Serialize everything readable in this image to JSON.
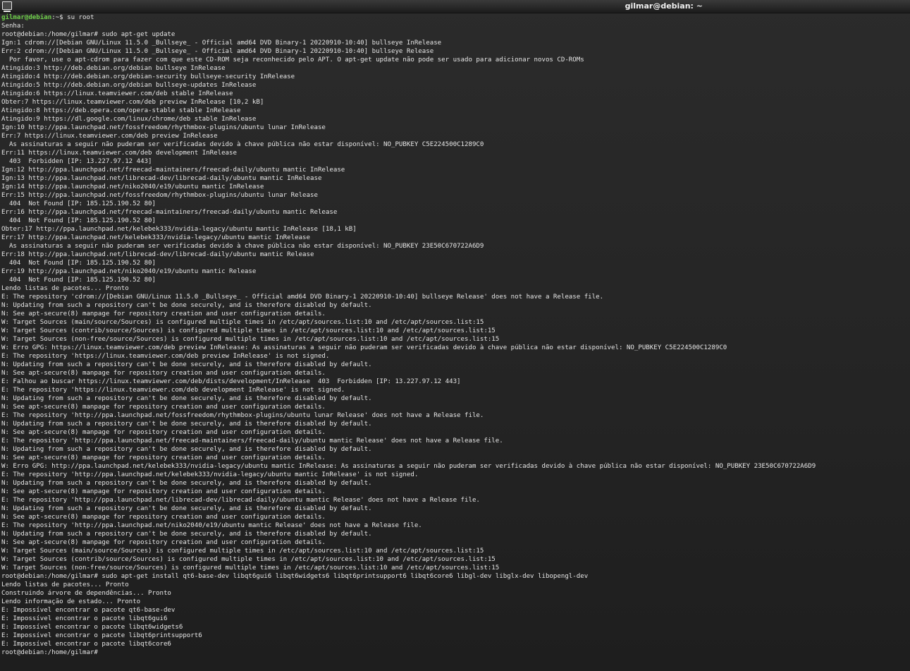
{
  "window": {
    "title": "gilmar@debian: ~",
    "icon": "terminal-icon"
  },
  "colors": {
    "prompt_user": "#6fd04a",
    "text": "#e6e6e6",
    "background": "#262626"
  },
  "terminal": {
    "first_prompt": {
      "user_host": "gilmar@debian",
      "path": ":~$",
      "command": " su root"
    },
    "lines": [
      "Senha:",
      "root@debian:/home/gilmar# sudo apt-get update",
      "Ign:1 cdrom://[Debian GNU/Linux 11.5.0 _Bullseye_ - Official amd64 DVD Binary-1 20220910-10:40] bullseye InRelease",
      "Err:2 cdrom://[Debian GNU/Linux 11.5.0 _Bullseye_ - Official amd64 DVD Binary-1 20220910-10:40] bullseye Release",
      "  Por favor, use o apt-cdrom para fazer com que este CD-ROM seja reconhecido pelo APT. O apt-get update não pode ser usado para adicionar novos CD-ROMs",
      "Atingido:3 http://deb.debian.org/debian bullseye InRelease",
      "Atingido:4 http://deb.debian.org/debian-security bullseye-security InRelease",
      "Atingido:5 http://deb.debian.org/debian bullseye-updates InRelease",
      "Atingido:6 https://linux.teamviewer.com/deb stable InRelease",
      "Obter:7 https://linux.teamviewer.com/deb preview InRelease [10,2 kB]",
      "Atingido:8 https://deb.opera.com/opera-stable stable InRelease",
      "Atingido:9 https://dl.google.com/linux/chrome/deb stable InRelease",
      "Ign:10 http://ppa.launchpad.net/fossfreedom/rhythmbox-plugins/ubuntu lunar InRelease",
      "Err:7 https://linux.teamviewer.com/deb preview InRelease",
      "  As assinaturas a seguir não puderam ser verificadas devido à chave pública não estar disponível: NO_PUBKEY C5E224500C1289C0",
      "Err:11 https://linux.teamviewer.com/deb development InRelease",
      "  403  Forbidden [IP: 13.227.97.12 443]",
      "Ign:12 http://ppa.launchpad.net/freecad-maintainers/freecad-daily/ubuntu mantic InRelease",
      "Ign:13 http://ppa.launchpad.net/librecad-dev/librecad-daily/ubuntu mantic InRelease",
      "Ign:14 http://ppa.launchpad.net/niko2040/e19/ubuntu mantic InRelease",
      "Err:15 http://ppa.launchpad.net/fossfreedom/rhythmbox-plugins/ubuntu lunar Release",
      "  404  Not Found [IP: 185.125.190.52 80]",
      "Err:16 http://ppa.launchpad.net/freecad-maintainers/freecad-daily/ubuntu mantic Release",
      "  404  Not Found [IP: 185.125.190.52 80]",
      "Obter:17 http://ppa.launchpad.net/kelebek333/nvidia-legacy/ubuntu mantic InRelease [18,1 kB]",
      "Err:17 http://ppa.launchpad.net/kelebek333/nvidia-legacy/ubuntu mantic InRelease",
      "  As assinaturas a seguir não puderam ser verificadas devido à chave pública não estar disponível: NO_PUBKEY 23E50C670722A6D9",
      "Err:18 http://ppa.launchpad.net/librecad-dev/librecad-daily/ubuntu mantic Release",
      "  404  Not Found [IP: 185.125.190.52 80]",
      "Err:19 http://ppa.launchpad.net/niko2040/e19/ubuntu mantic Release",
      "  404  Not Found [IP: 185.125.190.52 80]",
      "Lendo listas de pacotes... Pronto",
      "E: The repository 'cdrom://[Debian GNU/Linux 11.5.0 _Bullseye_ - Official amd64 DVD Binary-1 20220910-10:40] bullseye Release' does not have a Release file.",
      "N: Updating from such a repository can't be done securely, and is therefore disabled by default.",
      "N: See apt-secure(8) manpage for repository creation and user configuration details.",
      "W: Target Sources (main/source/Sources) is configured multiple times in /etc/apt/sources.list:10 and /etc/apt/sources.list:15",
      "W: Target Sources (contrib/source/Sources) is configured multiple times in /etc/apt/sources.list:10 and /etc/apt/sources.list:15",
      "W: Target Sources (non-free/source/Sources) is configured multiple times in /etc/apt/sources.list:10 and /etc/apt/sources.list:15",
      "W: Erro GPG: https://linux.teamviewer.com/deb preview InRelease: As assinaturas a seguir não puderam ser verificadas devido à chave pública não estar disponível: NO_PUBKEY C5E224500C1289C0",
      "E: The repository 'https://linux.teamviewer.com/deb preview InRelease' is not signed.",
      "N: Updating from such a repository can't be done securely, and is therefore disabled by default.",
      "N: See apt-secure(8) manpage for repository creation and user configuration details.",
      "E: Falhou ao buscar https://linux.teamviewer.com/deb/dists/development/InRelease  403  Forbidden [IP: 13.227.97.12 443]",
      "E: The repository 'https://linux.teamviewer.com/deb development InRelease' is not signed.",
      "N: Updating from such a repository can't be done securely, and is therefore disabled by default.",
      "N: See apt-secure(8) manpage for repository creation and user configuration details.",
      "E: The repository 'http://ppa.launchpad.net/fossfreedom/rhythmbox-plugins/ubuntu lunar Release' does not have a Release file.",
      "N: Updating from such a repository can't be done securely, and is therefore disabled by default.",
      "N: See apt-secure(8) manpage for repository creation and user configuration details.",
      "E: The repository 'http://ppa.launchpad.net/freecad-maintainers/freecad-daily/ubuntu mantic Release' does not have a Release file.",
      "N: Updating from such a repository can't be done securely, and is therefore disabled by default.",
      "N: See apt-secure(8) manpage for repository creation and user configuration details.",
      "W: Erro GPG: http://ppa.launchpad.net/kelebek333/nvidia-legacy/ubuntu mantic InRelease: As assinaturas a seguir não puderam ser verificadas devido à chave pública não estar disponível: NO_PUBKEY 23E50C670722A6D9",
      "E: The repository 'http://ppa.launchpad.net/kelebek333/nvidia-legacy/ubuntu mantic InRelease' is not signed.",
      "N: Updating from such a repository can't be done securely, and is therefore disabled by default.",
      "N: See apt-secure(8) manpage for repository creation and user configuration details.",
      "E: The repository 'http://ppa.launchpad.net/librecad-dev/librecad-daily/ubuntu mantic Release' does not have a Release file.",
      "N: Updating from such a repository can't be done securely, and is therefore disabled by default.",
      "N: See apt-secure(8) manpage for repository creation and user configuration details.",
      "E: The repository 'http://ppa.launchpad.net/niko2040/e19/ubuntu mantic Release' does not have a Release file.",
      "N: Updating from such a repository can't be done securely, and is therefore disabled by default.",
      "N: See apt-secure(8) manpage for repository creation and user configuration details.",
      "W: Target Sources (main/source/Sources) is configured multiple times in /etc/apt/sources.list:10 and /etc/apt/sources.list:15",
      "W: Target Sources (contrib/source/Sources) is configured multiple times in /etc/apt/sources.list:10 and /etc/apt/sources.list:15",
      "W: Target Sources (non-free/source/Sources) is configured multiple times in /etc/apt/sources.list:10 and /etc/apt/sources.list:15",
      "root@debian:/home/gilmar# sudo apt-get install qt6-base-dev libqt6gui6 libqt6widgets6 libqt6printsupport6 libqt6core6 libgl-dev libglx-dev libopengl-dev",
      "Lendo listas de pacotes... Pronto",
      "Construindo árvore de dependências... Pronto",
      "Lendo informação de estado... Pronto",
      "E: Impossível encontrar o pacote qt6-base-dev",
      "E: Impossível encontrar o pacote libqt6gui6",
      "E: Impossível encontrar o pacote libqt6widgets6",
      "E: Impossível encontrar o pacote libqt6printsupport6",
      "E: Impossível encontrar o pacote libqt6core6",
      "root@debian:/home/gilmar# "
    ]
  }
}
